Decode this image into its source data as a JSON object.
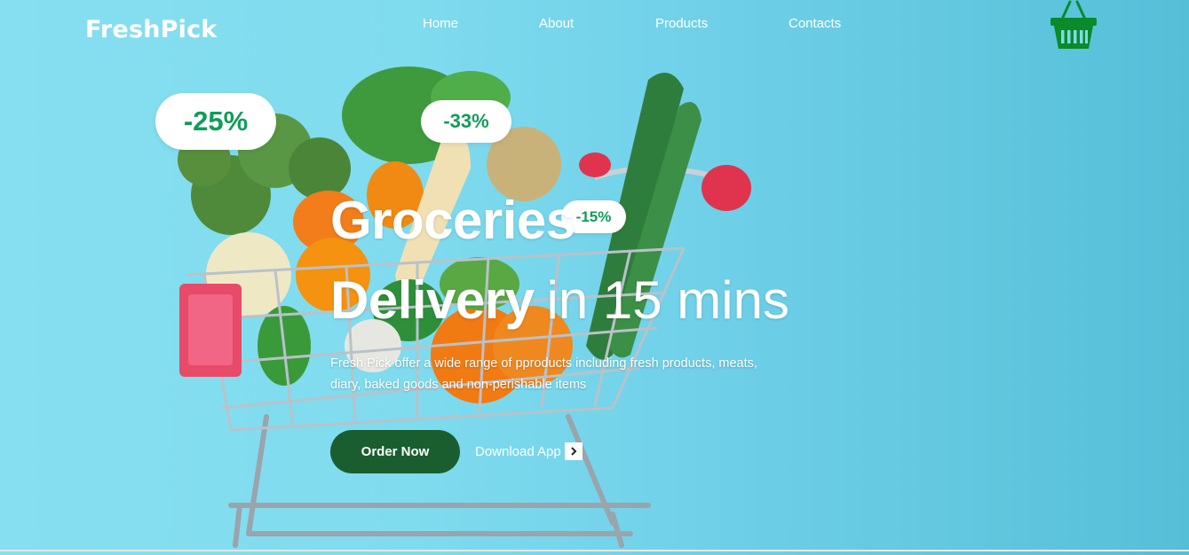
{
  "header": {
    "logo": "FreshPick",
    "nav": [
      "Home",
      "About",
      "Products",
      "Contacts"
    ],
    "cart_icon": "shopping-basket-icon"
  },
  "badges": [
    "-25%",
    "-33%",
    "-15%"
  ],
  "hero": {
    "line1": "Groceries",
    "line2_strong": "Delivery",
    "line2_light": "in 15 mins",
    "description": "Fresh Pick offer a wide range of pproducts including fresh products, meats, diary, baked goods and non-perishable items",
    "order_button": "Order Now",
    "download_link": "Download App",
    "download_icon": "chevron-right-icon"
  },
  "colors": {
    "accent_green": "#0f9d58",
    "button_green": "#1a5e30",
    "basket_green": "#0a8a2a",
    "background": "#7fdbee"
  }
}
